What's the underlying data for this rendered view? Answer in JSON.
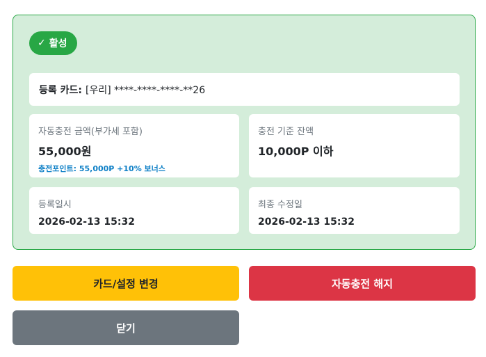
{
  "status": {
    "icon": "check-icon",
    "check": "✓",
    "label": "활성"
  },
  "registered_card": {
    "label": "등록 카드:",
    "value": "[우리] ****-****-****-**26"
  },
  "charge_amount": {
    "label": "자동충전 금액(부가세 포함)",
    "value": "55,000원",
    "bonus": "충전포인트: 55,000P +10% 보너스"
  },
  "threshold": {
    "label": "충전 기준 잔액",
    "value": "10,000P 이하"
  },
  "registered_at": {
    "label": "등록일시",
    "value": "2026-02-13 15:32"
  },
  "modified_at": {
    "label": "최종 수정일",
    "value": "2026-02-13 15:32"
  },
  "buttons": {
    "change": "카드/설정 변경",
    "cancel": "자동충전 해지",
    "close": "닫기"
  },
  "colors": {
    "panel_bg": "#d4edda",
    "panel_border": "#28a745",
    "badge": "#28a745",
    "bonus_text": "#0d7fc6",
    "change_btn": "#ffc107",
    "cancel_btn": "#dc3545",
    "close_btn": "#6c757d"
  }
}
